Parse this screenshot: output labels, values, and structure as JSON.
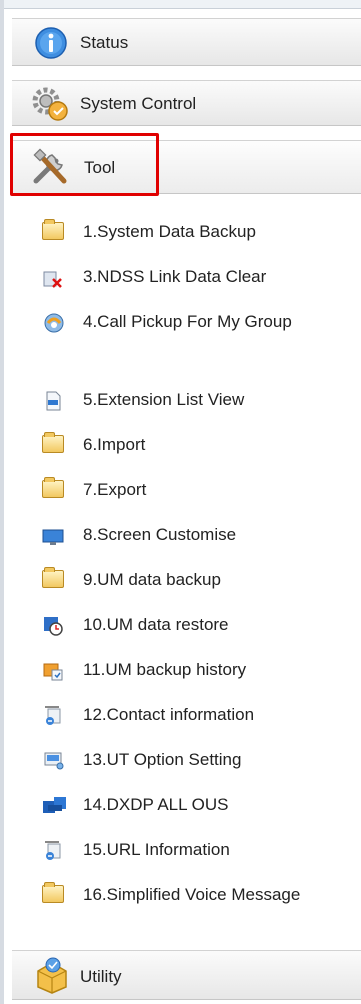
{
  "sections": {
    "status": "Status",
    "system_control": "System Control",
    "tool": "Tool",
    "utility": "Utility"
  },
  "tool_items": [
    {
      "label": "1.System Data Backup",
      "icon": "folder-icon"
    },
    {
      "label": "3.NDSS Link Data Clear",
      "icon": "data-clear-icon"
    },
    {
      "label": "4.Call Pickup For My Group",
      "icon": "call-pickup-icon"
    },
    {
      "label": "5.Extension List View",
      "icon": "document-icon"
    },
    {
      "label": "6.Import",
      "icon": "folder-icon"
    },
    {
      "label": "7.Export",
      "icon": "folder-icon"
    },
    {
      "label": "8.Screen Customise",
      "icon": "monitor-icon"
    },
    {
      "label": "9.UM data backup",
      "icon": "folder-icon"
    },
    {
      "label": "10.UM data restore",
      "icon": "restore-icon"
    },
    {
      "label": "11.UM backup history",
      "icon": "history-icon"
    },
    {
      "label": "12.Contact information",
      "icon": "contact-info-icon"
    },
    {
      "label": "13.UT Option Setting",
      "icon": "option-setting-icon"
    },
    {
      "label": "14.DXDP ALL OUS",
      "icon": "dxdp-icon"
    },
    {
      "label": "15.URL Information",
      "icon": "url-info-icon"
    },
    {
      "label": "16.Simplified Voice Message",
      "icon": "folder-icon"
    }
  ],
  "colors": {
    "highlight": "#e00000",
    "status_icon": "#2f7fd6",
    "folder": "#f2c860"
  }
}
